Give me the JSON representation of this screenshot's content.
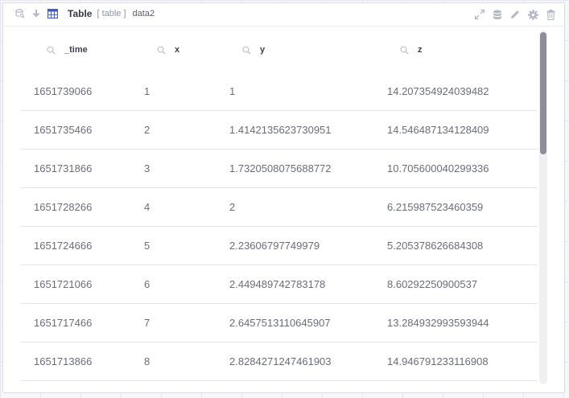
{
  "panel": {
    "title": "Table",
    "subtitle": "[ table ]",
    "name": "data2",
    "icons": {
      "left": [
        "database-search-icon",
        "download-icon",
        "table-icon"
      ],
      "right": [
        "expand-icon",
        "database-icon",
        "edit-icon",
        "settings-icon",
        "delete-icon"
      ]
    },
    "colors": {
      "accent": "#3b5bdb",
      "icon": "#b3b8c6"
    }
  },
  "table": {
    "columns": [
      "_time",
      "x",
      "y",
      "z"
    ],
    "rows": [
      [
        "1651739066",
        "1",
        "1",
        "14.207354924039482"
      ],
      [
        "1651735466",
        "2",
        "1.4142135623730951",
        "14.546487134128409"
      ],
      [
        "1651731866",
        "3",
        "1.7320508075688772",
        "10.705600040299336"
      ],
      [
        "1651728266",
        "4",
        "2",
        "6.215987523460359"
      ],
      [
        "1651724666",
        "5",
        "2.23606797749979",
        "5.205378626684308"
      ],
      [
        "1651721066",
        "6",
        "2.449489742783178",
        "8.60292250900537"
      ],
      [
        "1651717466",
        "7",
        "2.6457513110645907",
        "13.284932993593944"
      ],
      [
        "1651713866",
        "8",
        "2.8284271247461903",
        "14.946791233116908"
      ]
    ]
  }
}
